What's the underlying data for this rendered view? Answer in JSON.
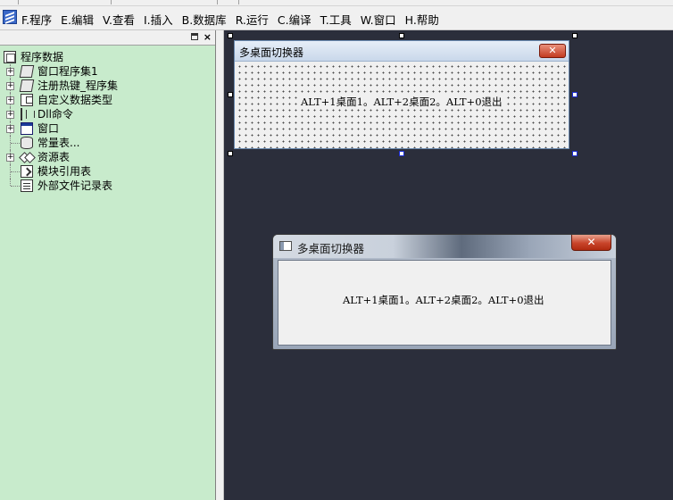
{
  "menubar": {
    "items": [
      "F.程序",
      "E.编辑",
      "V.查看",
      "I.插入",
      "B.数据库",
      "R.运行",
      "C.编译",
      "T.工具",
      "W.窗口",
      "H.帮助"
    ]
  },
  "left_panel": {
    "tree": {
      "root": "程序数据",
      "items": [
        "窗口程序集1",
        "注册热键_程序集",
        "自定义数据类型",
        "Dll命令",
        "窗口",
        "常量表...",
        "资源表",
        "模块引用表",
        "外部文件记录表"
      ]
    }
  },
  "design_form": {
    "title": "多桌面切换器",
    "label": "ALT+1桌面1。ALT+2桌面2。ALT+0退出"
  },
  "runtime_window": {
    "title": "多桌面切换器",
    "label": "ALT+1桌面1。ALT+2桌面2。ALT+0退出"
  },
  "colors": {
    "tree_background": "#c8ebcc",
    "canvas_background": "#2b2e3b",
    "close_button": "#c8442a"
  }
}
